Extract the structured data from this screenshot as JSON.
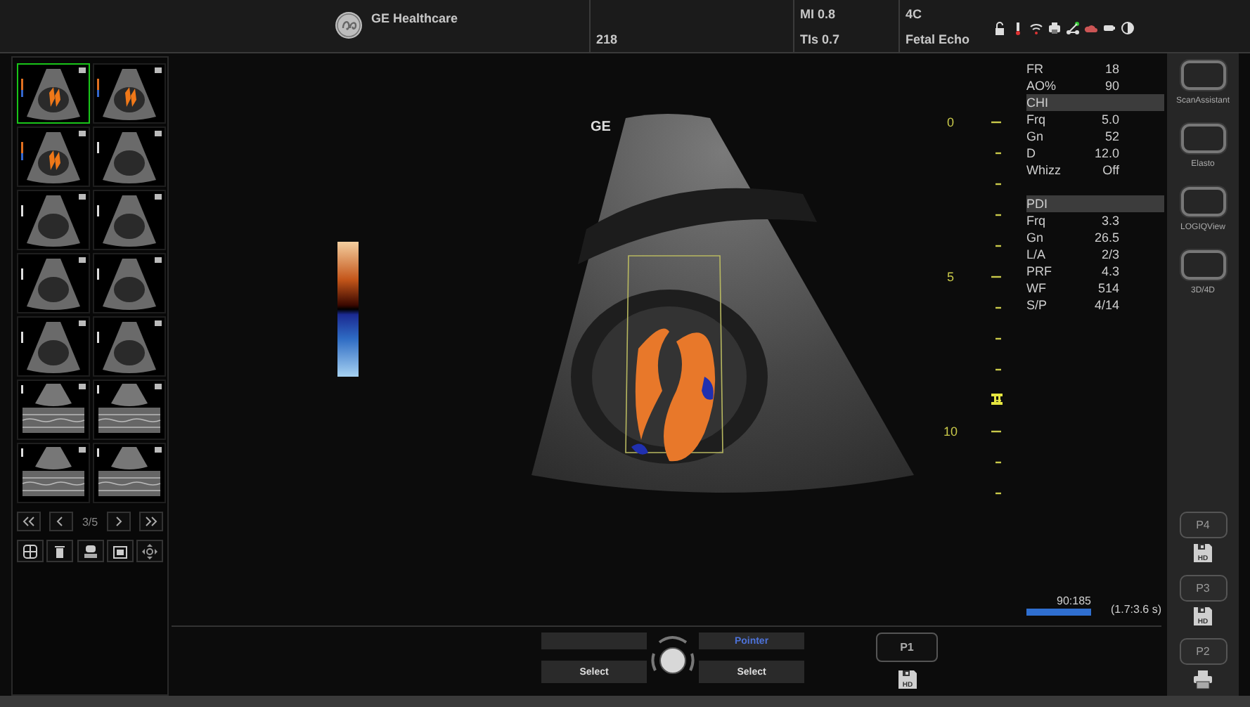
{
  "header": {
    "brand": "GE Healthcare",
    "frame_count": "218",
    "mi": "MI 0.8",
    "tis": "TIs 0.7",
    "preset": "4C",
    "application": "Fetal Echo"
  },
  "thumbnails": [
    {
      "kind": "color",
      "selected": true
    },
    {
      "kind": "color",
      "selected": false
    },
    {
      "kind": "color",
      "selected": false
    },
    {
      "kind": "bw",
      "selected": false
    },
    {
      "kind": "bw",
      "selected": false
    },
    {
      "kind": "bw",
      "selected": false
    },
    {
      "kind": "bw",
      "selected": false
    },
    {
      "kind": "bw",
      "selected": false
    },
    {
      "kind": "bw",
      "selected": false
    },
    {
      "kind": "bw",
      "selected": false
    },
    {
      "kind": "mmode",
      "selected": false
    },
    {
      "kind": "mmode",
      "selected": false
    },
    {
      "kind": "mmode",
      "selected": false
    },
    {
      "kind": "mmode",
      "selected": false
    }
  ],
  "pager": {
    "page": "3/5"
  },
  "image": {
    "probe_mark": "GE",
    "depth_labels": [
      "0",
      "5",
      "10"
    ]
  },
  "params": {
    "general": [
      {
        "label": "FR",
        "value": "18"
      },
      {
        "label": "AO%",
        "value": "90"
      }
    ],
    "sections": [
      {
        "title": "CHI",
        "rows": [
          {
            "label": "Frq",
            "value": "5.0"
          },
          {
            "label": "Gn",
            "value": "52"
          },
          {
            "label": "D",
            "value": "12.0"
          },
          {
            "label": "Whizz",
            "value": "Off"
          }
        ]
      },
      {
        "title": "PDI",
        "rows": [
          {
            "label": "Frq",
            "value": "3.3"
          },
          {
            "label": "Gn",
            "value": "26.5"
          },
          {
            "label": "L/A",
            "value": "2/3"
          },
          {
            "label": "PRF",
            "value": "4.3"
          },
          {
            "label": "WF",
            "value": "514"
          },
          {
            "label": "S/P",
            "value": "4/14"
          }
        ]
      }
    ]
  },
  "cine": {
    "frames": "90:185",
    "time": "(1.7:3.6 s)"
  },
  "trackball": {
    "top_right": "Pointer",
    "left": "Select",
    "right": "Select"
  },
  "p1": {
    "label": "P1",
    "kind": "save",
    "icon_text": "HD"
  },
  "sidebar": {
    "modes": [
      "ScanAssistant",
      "Elasto",
      "LOGIQView",
      "3D/4D"
    ],
    "print_keys": [
      {
        "label": "P4",
        "kind": "save",
        "icon_text": "HD"
      },
      {
        "label": "P3",
        "kind": "save",
        "icon_text": "HD"
      },
      {
        "label": "P2",
        "kind": "printer"
      }
    ]
  }
}
